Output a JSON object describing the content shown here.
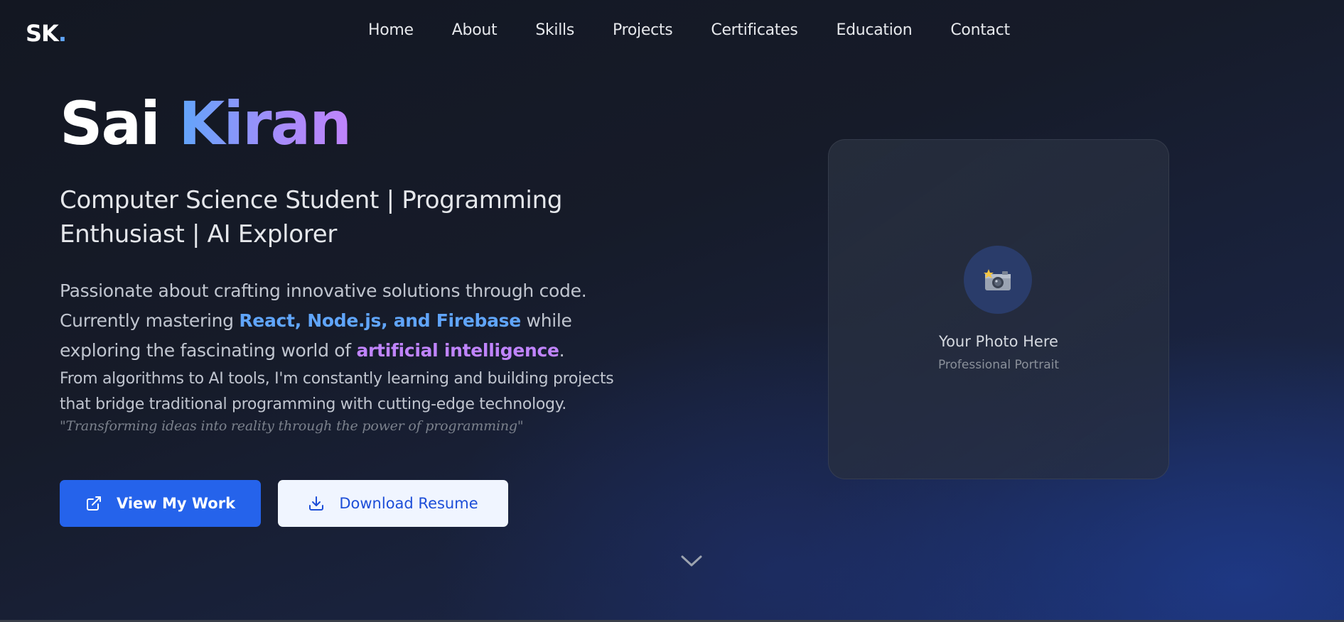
{
  "logo": {
    "text": "SK",
    "dot": "."
  },
  "nav": {
    "items": [
      "Home",
      "About",
      "Skills",
      "Projects",
      "Certificates",
      "Education",
      "Contact"
    ]
  },
  "hero": {
    "first_name": "Sai",
    "last_name": "Kiran",
    "subtitle_line1": "Computer Science Student | Programming",
    "subtitle_line2": "Enthusiast | AI Explorer",
    "desc_part1": "Passionate about crafting innovative solutions through code. Currently mastering ",
    "desc_highlight1": "React, Node.js, and Firebase",
    "desc_part2": " while exploring the fascinating world of ",
    "desc_highlight2": "artificial intelligence",
    "desc_part3": ".",
    "desc2": "From algorithms to AI tools, I'm constantly learning and building projects that bridge traditional programming with cutting-edge technology.",
    "quote": "\"Transforming ideas into reality through the power of programming\"",
    "primary_button": "View My Work",
    "secondary_button": "Download Resume"
  },
  "photo": {
    "title": "Your Photo Here",
    "subtitle": "Professional Portrait",
    "icon": "camera-icon"
  },
  "colors": {
    "accent_blue": "#2563eb",
    "highlight_blue": "#60a5fa",
    "highlight_purple": "#c084fc"
  }
}
